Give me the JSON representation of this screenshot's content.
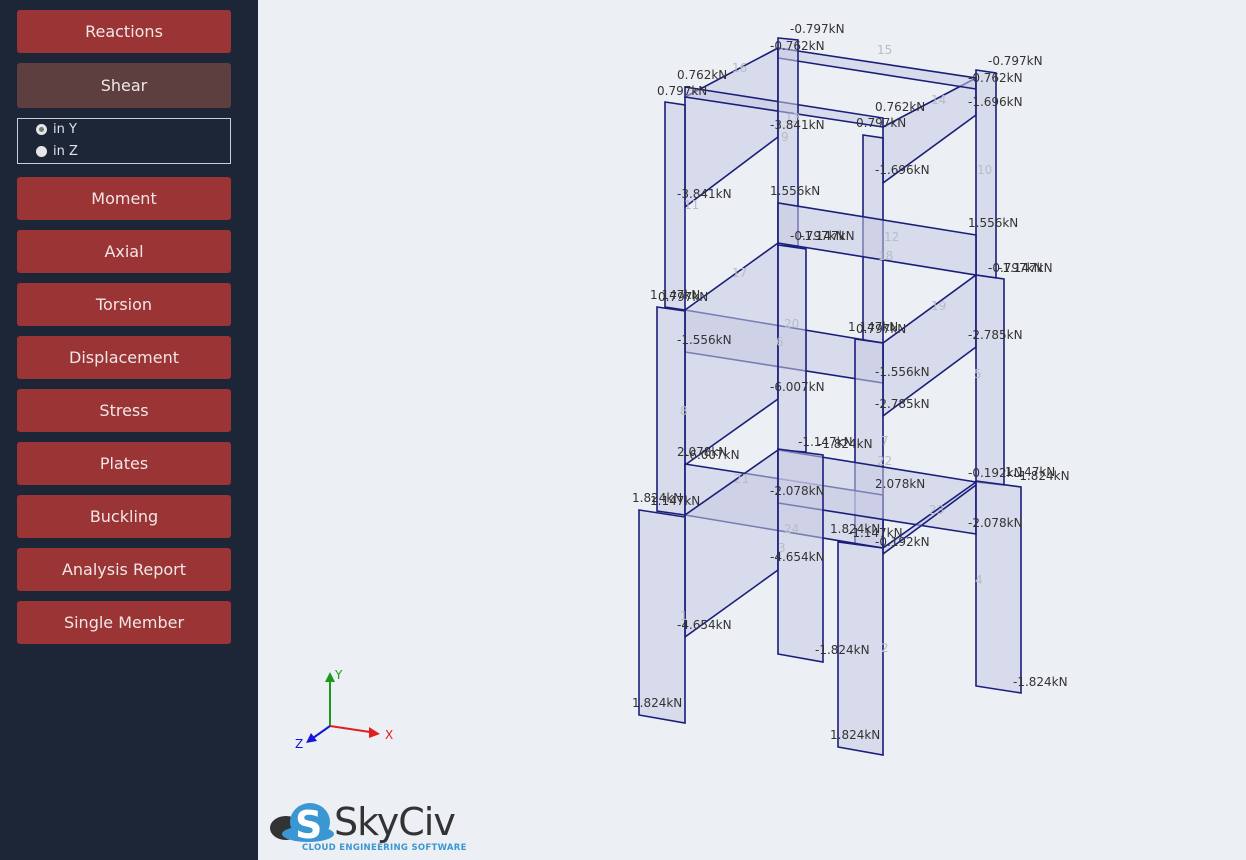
{
  "sidebar": {
    "buttons": [
      {
        "label": "Reactions"
      },
      {
        "label": "Shear",
        "active": true
      },
      {
        "label": "Moment"
      },
      {
        "label": "Axial"
      },
      {
        "label": "Torsion"
      },
      {
        "label": "Displacement"
      },
      {
        "label": "Stress"
      },
      {
        "label": "Plates"
      },
      {
        "label": "Buckling"
      },
      {
        "label": "Analysis Report"
      },
      {
        "label": "Single Member"
      }
    ],
    "shear_options": [
      {
        "label": "in Y",
        "selected": true
      },
      {
        "label": "in Z",
        "selected": false
      }
    ]
  },
  "colors": {
    "button": "#9b3434",
    "button_active": "#5e3f3f",
    "sidebar_bg": "#1d2636",
    "diagram_stroke": "#1a1f7a",
    "diagram_fill": "#d9dbea"
  },
  "axes": {
    "x": "X",
    "y": "Y",
    "z": "Z"
  },
  "diagram": {
    "member_numbers": [
      "16",
      "15",
      "14",
      "13",
      "9",
      "11",
      "10",
      "12",
      "18",
      "17",
      "20",
      "6",
      "19",
      "8",
      "5",
      "7",
      "22",
      "21",
      "24",
      "3",
      "23",
      "1",
      "2",
      "4"
    ],
    "labels": [
      "-0.797kN",
      "-0.762kN",
      "0.762kN",
      "0.797kN",
      "0.762kN",
      "0.797kN",
      "-0.797kN",
      "-0.762kN",
      "-1.696kN",
      "-3.841kN",
      "-1.696kN",
      "-3.841kN",
      "1.556kN",
      "1.556kN",
      "-0.797kN",
      "-1.147kN",
      "-0.797kN",
      "-1.147kN",
      "1.147kN",
      "0.797kN",
      "-1.556kN",
      "1.147kN",
      "0.797kN",
      "-2.785kN",
      "-1.556kN",
      "-6.007kN",
      "-2.785kN",
      "-1.147kN",
      "-1.824kN",
      "2.078kN",
      "-6.007kN",
      "-0.192kN",
      "1.147kN",
      "-1.824kN",
      "2.078kN",
      "-2.078kN",
      "1.824kN",
      "1.147kN",
      "-2.078kN",
      "1.824kN",
      "-1.147kN",
      "-0.192kN",
      "-4.654kN",
      "-4.654kN",
      "-1.824kN",
      "-1.824kN",
      "1.824kN",
      "1.824kN"
    ]
  },
  "logo": {
    "name": "SkyCiv",
    "tagline": "CLOUD ENGINEERING SOFTWARE"
  }
}
